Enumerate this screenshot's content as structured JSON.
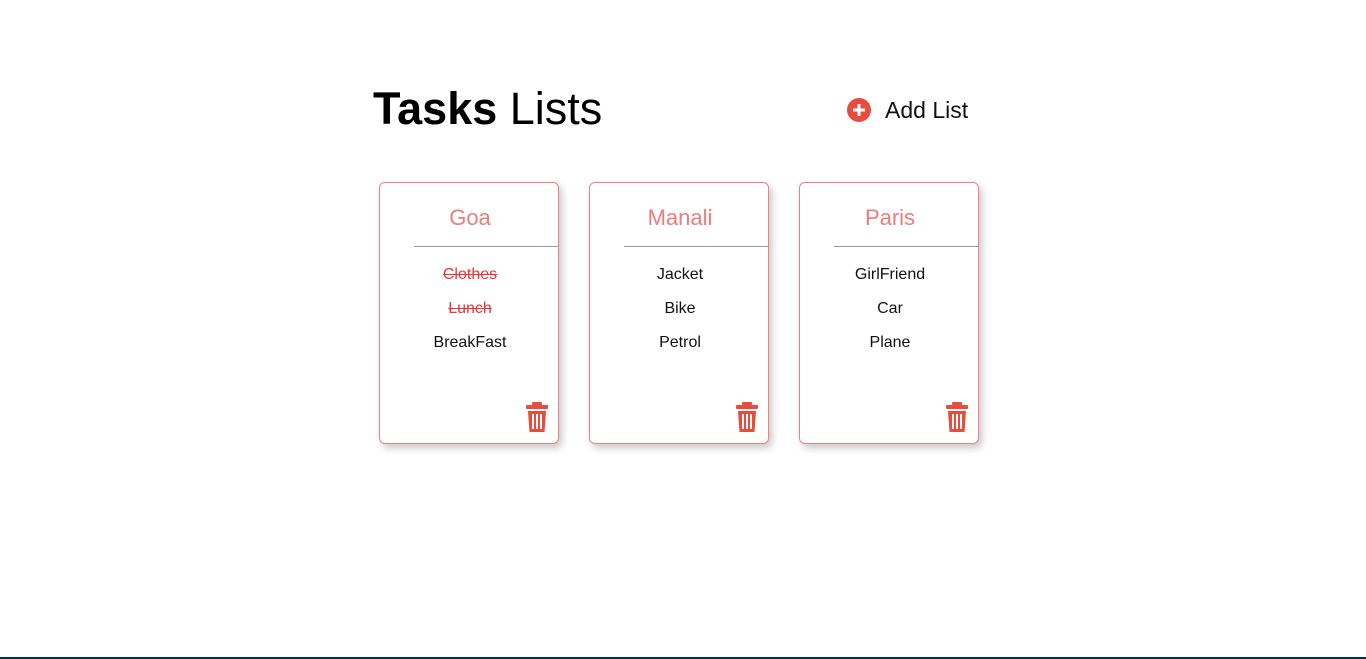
{
  "header": {
    "title_bold": "Tasks",
    "title_rest": "Lists",
    "add_list_label": "Add List"
  },
  "colors": {
    "accent": "#e74c3c",
    "card_border": "#f08080",
    "card_title": "#f07b7b",
    "done_text": "#e53935"
  },
  "icons": {
    "add": "plus-circle-icon",
    "delete": "trash-icon"
  },
  "lists": [
    {
      "title": "Goa",
      "tasks": [
        {
          "text": "Clothes",
          "done": true
        },
        {
          "text": "Lunch",
          "done": true
        },
        {
          "text": "BreakFast",
          "done": false
        }
      ]
    },
    {
      "title": "Manali",
      "tasks": [
        {
          "text": "Jacket",
          "done": false
        },
        {
          "text": "Bike",
          "done": false
        },
        {
          "text": "Petrol",
          "done": false
        }
      ]
    },
    {
      "title": "Paris",
      "tasks": [
        {
          "text": "GirlFriend",
          "done": false
        },
        {
          "text": "Car",
          "done": false
        },
        {
          "text": "Plane",
          "done": false
        }
      ]
    }
  ]
}
